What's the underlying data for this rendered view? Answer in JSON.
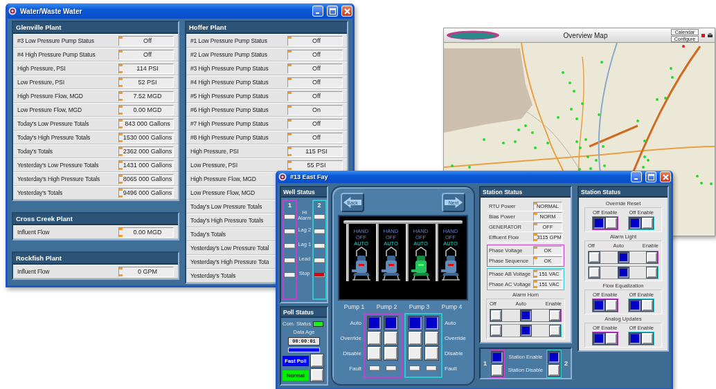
{
  "water_window": {
    "title": "Water/Waste Water",
    "columns": [
      {
        "panels": [
          {
            "title": "Glenville Plant",
            "rows": [
              {
                "label": "#3 Low Pressure Pump Status",
                "value": "Off",
                "kind": "status"
              },
              {
                "label": "#4 High Pressure Pump Status",
                "value": "Off",
                "kind": "status"
              },
              {
                "label": "High Pressure, PSI",
                "value": "114 PSI",
                "kind": "analog"
              },
              {
                "label": "Low Pressure, PSI",
                "value": "52 PSI",
                "kind": "analog"
              },
              {
                "label": "High Pressure Flow, MGD",
                "value": "7.52 MGD",
                "kind": "analog"
              },
              {
                "label": "Low Pressure Flow, MGD",
                "value": "0.00 MGD",
                "kind": "analog"
              },
              {
                "label": "Today's Low Pressure Totals",
                "value": "843 000 Gallons",
                "kind": "analog"
              },
              {
                "label": "Today's High Pressure Totals",
                "value": "1530 000 Gallons",
                "kind": "analog"
              },
              {
                "label": "Today's Totals",
                "value": "2362 000 Gallons",
                "kind": "analog"
              },
              {
                "label": "Yesterday's Low Pressure Totals",
                "value": "1431 000 Gallons",
                "kind": "analog"
              },
              {
                "label": "Yesterday's High Pressure Totals",
                "value": "8065 000 Gallons",
                "kind": "analog"
              },
              {
                "label": "Yesterday's Totals",
                "value": "9496 000 Gallons",
                "kind": "analog"
              }
            ]
          },
          {
            "title": "Cross Creek Plant",
            "rows": [
              {
                "label": "Influent Flow",
                "value": "0.00 MGD",
                "kind": "analog"
              }
            ]
          },
          {
            "title": "Rockfish Plant",
            "rows": [
              {
                "label": "Influent Flow",
                "value": "0 GPM",
                "kind": "analog"
              }
            ]
          }
        ]
      },
      {
        "panels": [
          {
            "title": "Hoffer Plant",
            "rows": [
              {
                "label": "#1 Low Pressure Pump Status",
                "value": "Off",
                "kind": "status"
              },
              {
                "label": "#2 Low Pressure Pump Status",
                "value": "Off",
                "kind": "status"
              },
              {
                "label": "#3 High Pressure Pump Status",
                "value": "Off",
                "kind": "status"
              },
              {
                "label": "#4 High Pressure Pump Status",
                "value": "Off",
                "kind": "status"
              },
              {
                "label": "#5 High Pressure Pump Status",
                "value": "Off",
                "kind": "status"
              },
              {
                "label": "#6 High Pressure Pump Status",
                "value": "On",
                "kind": "status"
              },
              {
                "label": "#7 High Pressure Pump Status",
                "value": "Off",
                "kind": "status"
              },
              {
                "label": "#8 High Pressure Pump Status",
                "value": "Off",
                "kind": "status"
              },
              {
                "label": "High Pressure, PSI",
                "value": "115 PSI",
                "kind": "analog"
              },
              {
                "label": "Low Pressure, PSI",
                "value": "55 PSI",
                "kind": "analog"
              },
              {
                "label": "High Pressure Flow, MGD",
                "kind": "label"
              },
              {
                "label": "Low Pressure Flow, MGD",
                "kind": "label"
              },
              {
                "label": "Today's Low Pressure Totals",
                "kind": "label"
              },
              {
                "label": "Today's High Pressure Totals",
                "kind": "label"
              },
              {
                "label": "Today's Totals",
                "kind": "label"
              },
              {
                "label": "Yesterday's Low Pressure Total",
                "kind": "label"
              },
              {
                "label": "Yesterday's High Pressure Tota",
                "kind": "label"
              },
              {
                "label": "Yesterday's Totals",
                "kind": "label"
              }
            ]
          }
        ]
      }
    ]
  },
  "map_window": {
    "title": "Overview Map",
    "buttons": [
      "Calendar",
      "Configure"
    ]
  },
  "station_window": {
    "title": "#13 East Fay",
    "well_status": {
      "title": "Well Status",
      "levels": [
        "Hi Alarm",
        "Lag 2",
        "Lag 1",
        "Lead",
        "Stop"
      ],
      "wells": [
        {
          "label": "1",
          "color": "#c040d0",
          "lights": [
            {
              "on": false
            },
            {
              "on": false
            },
            {
              "on": false
            },
            {
              "on": false
            },
            {
              "on": false
            }
          ]
        },
        {
          "label": "2",
          "color": "#30c8d0",
          "lights": [
            {
              "on": false
            },
            {
              "on": false
            },
            {
              "on": false
            },
            {
              "on": false
            },
            {
              "on": true
            }
          ]
        }
      ]
    },
    "poll_status": {
      "title": "Poll Status",
      "com_label": "Com. Status",
      "com_ok": true,
      "age_label": "Data Age",
      "age_value": "00:00:01",
      "level": 1,
      "modes": [
        {
          "label": "Fast Poll",
          "color": "#0000ff"
        },
        {
          "label": "Normal",
          "color": "#00ee00"
        }
      ]
    },
    "nav_buttons": [
      {
        "label": "Back",
        "kind": "back"
      },
      {
        "label": "Next",
        "kind": "forward"
      }
    ],
    "pumps": [
      {
        "name": "Pump 1",
        "running": false,
        "modes": [
          {
            "label": "HAND",
            "selected": false
          },
          {
            "label": "OFF",
            "selected": false
          },
          {
            "label": "AUTO",
            "selected": true
          }
        ]
      },
      {
        "name": "Pump 2",
        "running": false,
        "modes": [
          {
            "label": "HAND",
            "selected": false
          },
          {
            "label": "OFF",
            "selected": false
          },
          {
            "label": "AUTO",
            "selected": true
          }
        ]
      },
      {
        "name": "Pump 3",
        "running": true,
        "modes": [
          {
            "label": "HAND",
            "selected": false
          },
          {
            "label": "OFF",
            "selected": false
          },
          {
            "label": "AUTO",
            "selected": true
          }
        ]
      },
      {
        "name": "Pump 4",
        "running": false,
        "modes": [
          {
            "label": "HAND",
            "selected": false
          },
          {
            "label": "OFF",
            "selected": false
          },
          {
            "label": "AUTO",
            "selected": true
          }
        ]
      }
    ],
    "pump_groups": [
      {
        "color": "#c040d0"
      },
      {
        "color": "#30c8d0"
      }
    ],
    "pump_controls": [
      {
        "kind": "button",
        "left": "Auto",
        "right": "Auto",
        "cells": [
          {
            "selected": true
          },
          {
            "selected": true
          },
          {
            "selected": true
          },
          {
            "selected": true
          }
        ]
      },
      {
        "kind": "button",
        "left": "Override",
        "right": "Override",
        "cells": [
          {
            "selected": false
          },
          {
            "selected": false
          },
          {
            "selected": false
          },
          {
            "selected": false
          }
        ]
      },
      {
        "kind": "button",
        "left": "Disable",
        "right": "Disable",
        "cells": [
          {
            "selected": false
          },
          {
            "selected": false
          },
          {
            "selected": false
          },
          {
            "selected": false
          }
        ]
      },
      {
        "kind": "light",
        "left": "Fault",
        "right": "Fault",
        "cells": [
          {
            "on": false
          },
          {
            "on": false
          },
          {
            "on": false
          },
          {
            "on": false
          }
        ]
      }
    ],
    "station_status": {
      "title": "Station Status",
      "groups": [
        {
          "rows": [
            {
              "label": "RTU Power",
              "value": "NORMAL",
              "kind": "text"
            },
            {
              "label": "Bias Power",
              "value": "NORM",
              "kind": "text"
            },
            {
              "label": "GENERATOR",
              "value": "OFF",
              "kind": "text"
            },
            {
              "label": "Effluent Flow",
              "value": "3115 GPM",
              "kind": "analog"
            }
          ]
        },
        {
          "color": "#c040d0",
          "rows": [
            {
              "label": "Phase Voltage",
              "value": "OK",
              "kind": "text"
            },
            {
              "label": "Phase Sequence",
              "value": "OK",
              "kind": "text"
            }
          ]
        },
        {
          "color": "#30c8d0",
          "rows": [
            {
              "label": "Phase AB Voltage",
              "value": "151 VAC",
              "kind": "analog"
            },
            {
              "label": "Phase AC Voltage",
              "value": "151 VAC",
              "kind": "analog"
            }
          ]
        }
      ],
      "control": {
        "title": "Alarm Horn",
        "kind": "rows",
        "labels": [
          "Off",
          "Auto",
          "Enable"
        ],
        "units": [
          {
            "color": "#c040d0",
            "buttons": [
              {
                "selected": false
              },
              {
                "selected": true
              },
              {
                "selected": false
              }
            ]
          },
          {
            "color": "#30c8d0",
            "buttons": [
              {
                "selected": false
              },
              {
                "selected": true
              },
              {
                "selected": false
              }
            ]
          }
        ]
      }
    },
    "station_enable": {
      "labels": [
        "Station Enable",
        "Station Disable"
      ],
      "units": [
        {
          "label": "1",
          "color": "#c040d0",
          "buttons": [
            {
              "selected": true
            },
            {
              "selected": false
            }
          ]
        },
        {
          "label": "2",
          "color": "#30c8d0",
          "buttons": [
            {
              "selected": true
            },
            {
              "selected": false
            }
          ]
        }
      ]
    },
    "station_controls": {
      "title": "Station Status",
      "controls": [
        {
          "title": "Override Reset",
          "kind": "pairs",
          "units": [
            {
              "color": "#c040d0",
              "labels": [
                "Off",
                "Enable"
              ],
              "buttons": [
                {
                  "selected": true
                },
                {
                  "selected": false
                }
              ]
            },
            {
              "color": "#30c8d0",
              "labels": [
                "Off",
                "Enable"
              ],
              "buttons": [
                {
                  "selected": true
                },
                {
                  "selected": false
                }
              ]
            }
          ]
        },
        {
          "title": "Alarm Light",
          "kind": "rows",
          "labels": [
            "Off",
            "Auto",
            "Enable"
          ],
          "units": [
            {
              "color": "#c040d0",
              "buttons": [
                {
                  "selected": false
                },
                {
                  "selected": true
                },
                {
                  "selected": false
                }
              ]
            },
            {
              "color": "#30c8d0",
              "buttons": [
                {
                  "selected": false
                },
                {
                  "selected": true
                },
                {
                  "selected": false
                }
              ]
            }
          ]
        },
        {
          "title": "Flow Equalization",
          "kind": "pairs",
          "units": [
            {
              "color": "#c040d0",
              "labels": [
                "Off",
                "Enable"
              ],
              "buttons": [
                {
                  "selected": true
                },
                {
                  "selected": false
                }
              ]
            },
            {
              "color": "#30c8d0",
              "labels": [
                "Off",
                "Enable"
              ],
              "buttons": [
                {
                  "selected": true
                },
                {
                  "selected": false
                }
              ]
            }
          ]
        },
        {
          "title": "Analog Updates",
          "kind": "pairs",
          "units": [
            {
              "color": "#c040d0",
              "labels": [
                "Off",
                "Enable"
              ],
              "buttons": [
                {
                  "selected": true
                },
                {
                  "selected": false
                }
              ]
            },
            {
              "color": "#30c8d0",
              "labels": [
                "Off",
                "Enable"
              ],
              "buttons": [
                {
                  "selected": true
                },
                {
                  "selected": false
                }
              ]
            }
          ]
        }
      ]
    }
  }
}
